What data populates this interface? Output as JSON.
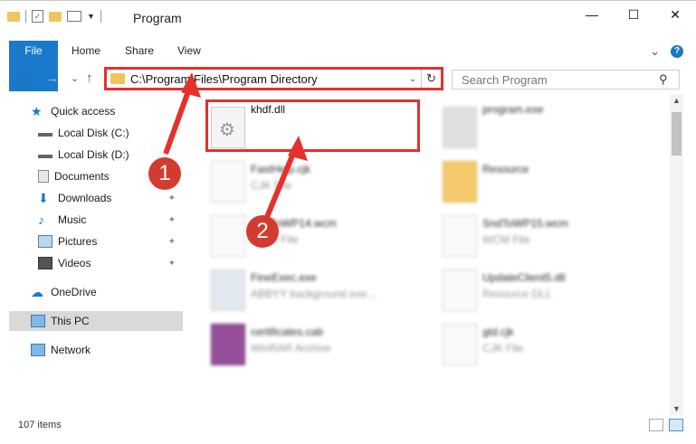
{
  "window": {
    "title": "Program",
    "controls": {
      "minimize": "—",
      "maximize": "☐",
      "close": "✕"
    }
  },
  "ribbon": {
    "tabs": [
      "File",
      "Home",
      "Share",
      "View"
    ],
    "expand_icon": "⌄",
    "help_icon": "?"
  },
  "navigation": {
    "back": "←",
    "forward": "→",
    "recent": "⌄",
    "up": "↑",
    "address_path": "C:\\Program Files\\Program Directory",
    "address_dropdown": "⌄",
    "refresh": "↻",
    "search_placeholder": "Search Program",
    "search_icon": "🔍"
  },
  "sidebar": {
    "items": [
      {
        "label": "Quick access",
        "icon": "star-icon"
      },
      {
        "label": "Local Disk (C:)",
        "icon": "drive-icon"
      },
      {
        "label": "Local Disk (D:)",
        "icon": "drive-icon"
      },
      {
        "label": "Documents",
        "icon": "documents-icon"
      },
      {
        "label": "Downloads",
        "icon": "downloads-icon",
        "pinned": true
      },
      {
        "label": "Music",
        "icon": "music-icon",
        "pinned": true
      },
      {
        "label": "Pictures",
        "icon": "pictures-icon",
        "pinned": true
      },
      {
        "label": "Videos",
        "icon": "videos-icon",
        "pinned": true
      },
      {
        "label": "OneDrive",
        "icon": "cloud-icon"
      },
      {
        "label": "This PC",
        "icon": "pc-icon",
        "selected": true
      },
      {
        "label": "Network",
        "icon": "network-icon"
      }
    ],
    "pin_glyph": "📌"
  },
  "files": [
    {
      "name": "khdf.dll",
      "type": "",
      "highlighted": true
    },
    {
      "name": "program.exe",
      "type": ""
    },
    {
      "name": "FastHelp.cjk",
      "type": "CJK File"
    },
    {
      "name": "Resource",
      "type": ""
    },
    {
      "name": "SndToWP14.wcm",
      "type": "WCM File"
    },
    {
      "name": "SndToWP15.wcm",
      "type": "WCM File"
    },
    {
      "name": "FineExec.exe",
      "type": "ABBYY background exe..."
    },
    {
      "name": "UpdateClient5.dll",
      "type": "Resource DLL"
    },
    {
      "name": "certificates.cab",
      "type": "WinRAR Archive"
    },
    {
      "name": "gtd.cjk",
      "type": "CJK File"
    }
  ],
  "callouts": [
    "1",
    "2"
  ],
  "status": {
    "item_count": "107 items"
  },
  "colors": {
    "accent": "#1979ca",
    "highlight": "#e5302c",
    "callout": "#d23b30"
  }
}
